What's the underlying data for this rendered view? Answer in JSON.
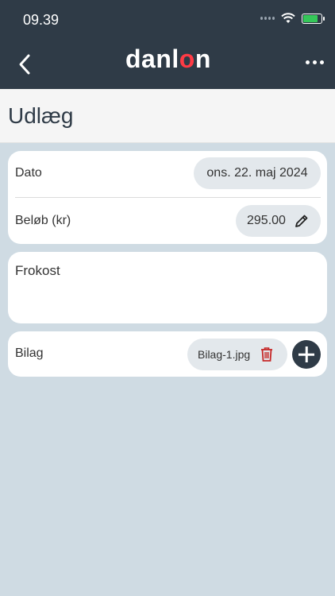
{
  "status_bar": {
    "time": "09.39"
  },
  "nav": {
    "logo_prefix": "danl",
    "logo_accent": "o",
    "logo_suffix": "n"
  },
  "page": {
    "title": "Udlæg"
  },
  "expense": {
    "date_label": "Dato",
    "date_value": "ons. 22. maj 2024",
    "amount_label": "Beløb (kr)",
    "amount_value": "295.00",
    "note": "Frokost"
  },
  "attachments": {
    "label": "Bilag",
    "file_name": "Bilag-1.jpg"
  },
  "colors": {
    "nav_bg": "#2f3b47",
    "accent": "#ff3b45",
    "page_bg": "#cfdbe3",
    "delete": "#c62828"
  },
  "icons": [
    "back-icon",
    "more-icon",
    "pencil-icon",
    "trash-icon",
    "plus-icon",
    "wifi-icon",
    "battery-icon"
  ]
}
